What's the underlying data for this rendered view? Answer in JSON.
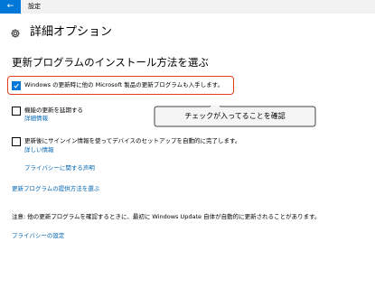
{
  "window": {
    "back_icon": "arrow-left-icon",
    "title": "設定"
  },
  "page": {
    "title_icon": "gear-icon",
    "title": "詳細オプション"
  },
  "section": {
    "heading": "更新プログラムのインストール方法を選ぶ"
  },
  "options": [
    {
      "label": "Windows の更新時に他の Microsoft 製品の更新プログラムも入手します。",
      "checked": true
    },
    {
      "label": "機能の更新を延期する",
      "checked": false,
      "link": "詳細情報"
    },
    {
      "label": "更新後にサインイン情報を使ってデバイスのセットアップを自動的に完了します。",
      "checked": false,
      "link": "詳しい情報"
    }
  ],
  "links": {
    "privacy_statement": "プライバシーに関する声明",
    "delivery_method": "更新プログラムの提供方法を選ぶ",
    "privacy_settings": "プライバシーの設定"
  },
  "note": "注意: 他の更新プログラムを確認するときに、最初に Windows Update 自体が自動的に更新されることがあります。",
  "annotation": {
    "callout_text": "チェックが入ってることを確認",
    "highlight_color": "#e23c1c"
  },
  "colors": {
    "accent": "#0078d7",
    "link": "#0066b4"
  }
}
